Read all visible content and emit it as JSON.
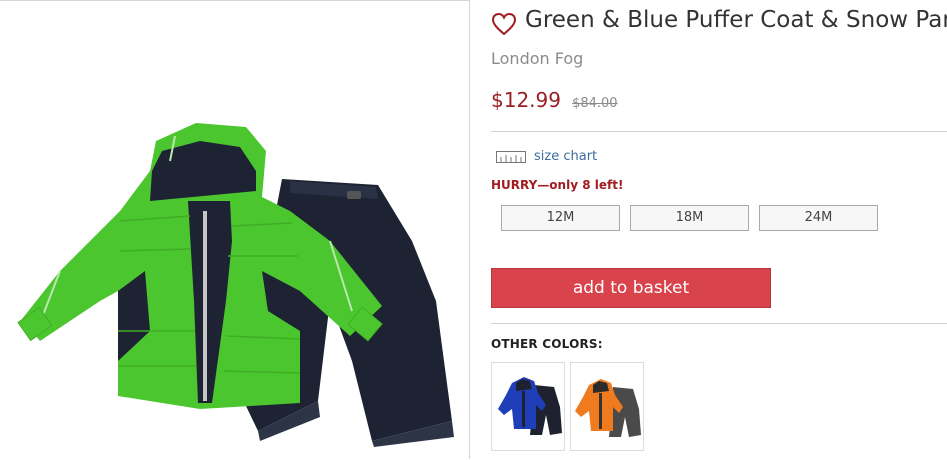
{
  "product": {
    "title": "Green & Blue Puffer Coat & Snow Pants",
    "brand": "London Fog",
    "price": "$12.99",
    "original_price": "$84.00",
    "image_label": "Green & Blue Puffer Coat & Snow Pants product image"
  },
  "size_chart": {
    "label": "size chart",
    "icon": "ruler-icon"
  },
  "stock": {
    "message": "HURRY—only 8 left!"
  },
  "sizes": [
    "12M",
    "18M",
    "24M"
  ],
  "actions": {
    "add_to_basket": "add to basket",
    "favorite_icon": "heart-icon"
  },
  "other_colors": {
    "label": "OTHER COLORS:",
    "items": [
      {
        "name": "Blue & Black",
        "jacket_color": "#1f3fb8",
        "pants_color": "#1e2230"
      },
      {
        "name": "Orange & Gray",
        "jacket_color": "#f07a1e",
        "pants_color": "#4a4a4a"
      }
    ]
  },
  "colors": {
    "price": "#9a1f23",
    "button": "#d9434b",
    "link": "#3d6c9c",
    "jacket_green": "#4cc62f",
    "navy": "#1d2333"
  }
}
